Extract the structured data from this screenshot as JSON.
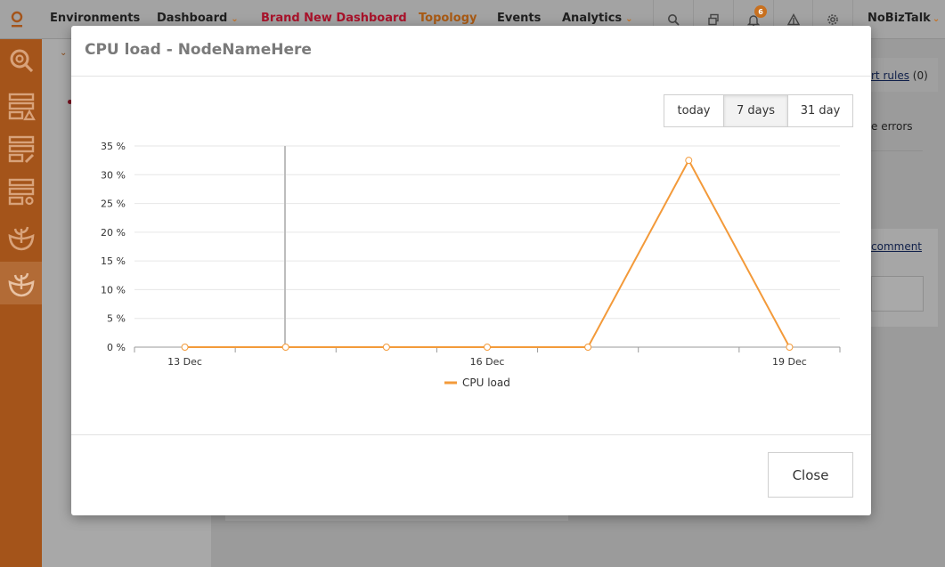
{
  "topnav": {
    "items": [
      {
        "label": "Environments",
        "color": "#1f1f1f",
        "chevron": false
      },
      {
        "label": "Dashboard",
        "color": "#1f1f1f",
        "chevron": true
      },
      {
        "label": "Brand New Dashboard",
        "color": "#a8132b",
        "chevron": false
      },
      {
        "label": "Topology",
        "color": "#a85a14",
        "chevron": false
      },
      {
        "label": "Events",
        "color": "#1f1f1f",
        "chevron": false
      },
      {
        "label": "Analytics",
        "color": "#1f1f1f",
        "chevron": true
      }
    ],
    "notification_count": "6",
    "user_label": "NoBizTalk"
  },
  "background": {
    "alert_rules_link": "rt rules",
    "alert_rules_count": "(0)",
    "errors_text": "e errors",
    "comment_link": "comment"
  },
  "modal": {
    "title": "CPU load - NodeNameHere",
    "ranges": [
      {
        "label": "today",
        "active": false
      },
      {
        "label": "7 days",
        "active": true
      },
      {
        "label": "31 day",
        "active": false
      }
    ],
    "close_label": "Close"
  },
  "colors": {
    "accent": "#f39a3a",
    "sidebar": "#a4541a"
  },
  "chart_data": {
    "type": "line",
    "title": "",
    "xlabel": "",
    "ylabel": "",
    "ylim": [
      0,
      35
    ],
    "y_ticks": [
      0,
      5,
      10,
      15,
      20,
      25,
      30,
      35
    ],
    "y_tick_suffix": " %",
    "x_tick_labels": [
      "13 Dec",
      "16 Dec",
      "19 Dec"
    ],
    "x": [
      "13 Dec",
      "14 Dec",
      "15 Dec",
      "16 Dec",
      "17 Dec",
      "18 Dec",
      "19 Dec"
    ],
    "series": [
      {
        "name": "CPU load",
        "values": [
          0,
          0,
          0,
          0,
          0,
          32.5,
          0
        ],
        "color": "#f39a3a"
      }
    ],
    "grid": true,
    "legend": "bottom"
  }
}
